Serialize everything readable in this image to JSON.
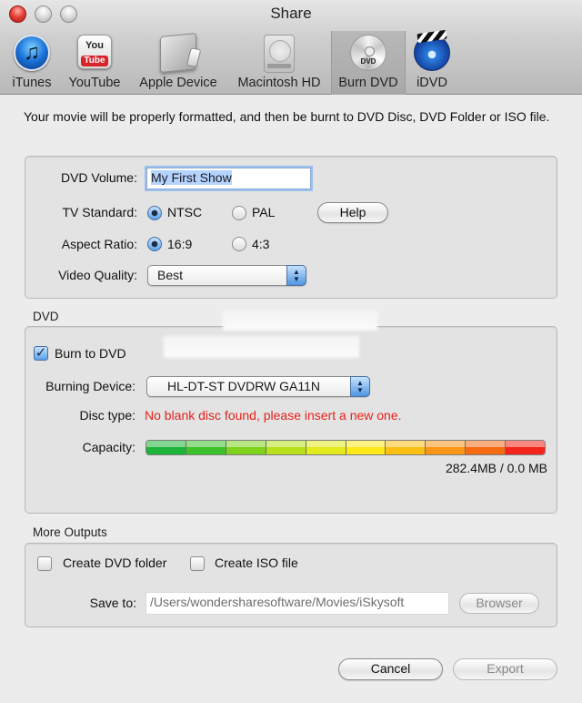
{
  "window": {
    "title": "Share"
  },
  "toolbar": {
    "items": [
      {
        "label": "iTunes",
        "icon": "itunes-icon",
        "selected": false
      },
      {
        "label": "YouTube",
        "icon": "youtube-icon",
        "selected": false,
        "icon_text_top": "You",
        "icon_text_bottom": "Tube"
      },
      {
        "label": "Apple Device",
        "icon": "apple-device-icon",
        "selected": false
      },
      {
        "label": "Macintosh HD",
        "icon": "hard-drive-icon",
        "selected": false
      },
      {
        "label": "Burn DVD",
        "icon": "dvd-disc-icon",
        "selected": true,
        "icon_text": "DVD"
      },
      {
        "label": "iDVD",
        "icon": "idvd-icon",
        "selected": false
      }
    ]
  },
  "intro_text": "Your movie will be properly formatted, and then be burnt to DVD Disc, DVD Folder or ISO file.",
  "settings": {
    "dvd_volume_label": "DVD Volume:",
    "dvd_volume_value": "My First Show",
    "tv_standard_label": "TV Standard:",
    "tv_standard_options": [
      "NTSC",
      "PAL"
    ],
    "tv_standard_selected": "NTSC",
    "help_button": "Help",
    "aspect_ratio_label": "Aspect Ratio:",
    "aspect_ratio_options": [
      "16:9",
      "4:3"
    ],
    "aspect_ratio_selected": "16:9",
    "video_quality_label": "Video Quality:",
    "video_quality_value": "Best"
  },
  "dvd_section": {
    "title": "DVD",
    "burn_to_dvd_label": "Burn to DVD",
    "burn_to_dvd_checked": true,
    "burning_device_label": "Burning Device:",
    "burning_device_value": "HL-DT-ST DVDRW GA11N",
    "disc_type_label": "Disc type:",
    "disc_type_value": "No blank disc found, please insert a new one.",
    "capacity_label": "Capacity:",
    "capacity_text": "282.4MB / 0.0 MB",
    "capacity_segments": 10,
    "capacity_colors": [
      "#1eb33a",
      "#3cc12a",
      "#7fd21c",
      "#b7e01a",
      "#e3ea1d",
      "#fde81a",
      "#fbbf14",
      "#f99617",
      "#f66a14",
      "#f3241b"
    ],
    "error_color": "#e8201a"
  },
  "more_outputs": {
    "title": "More Outputs",
    "create_dvd_folder_label": "Create DVD folder",
    "create_dvd_folder_checked": false,
    "create_iso_label": "Create ISO file",
    "create_iso_checked": false,
    "save_to_label": "Save to:",
    "save_to_path": "/Users/wondersharesoftware/Movies/iSkysoft",
    "browser_button": "Browser"
  },
  "footer": {
    "cancel_button": "Cancel",
    "export_button": "Export",
    "export_enabled": false
  }
}
